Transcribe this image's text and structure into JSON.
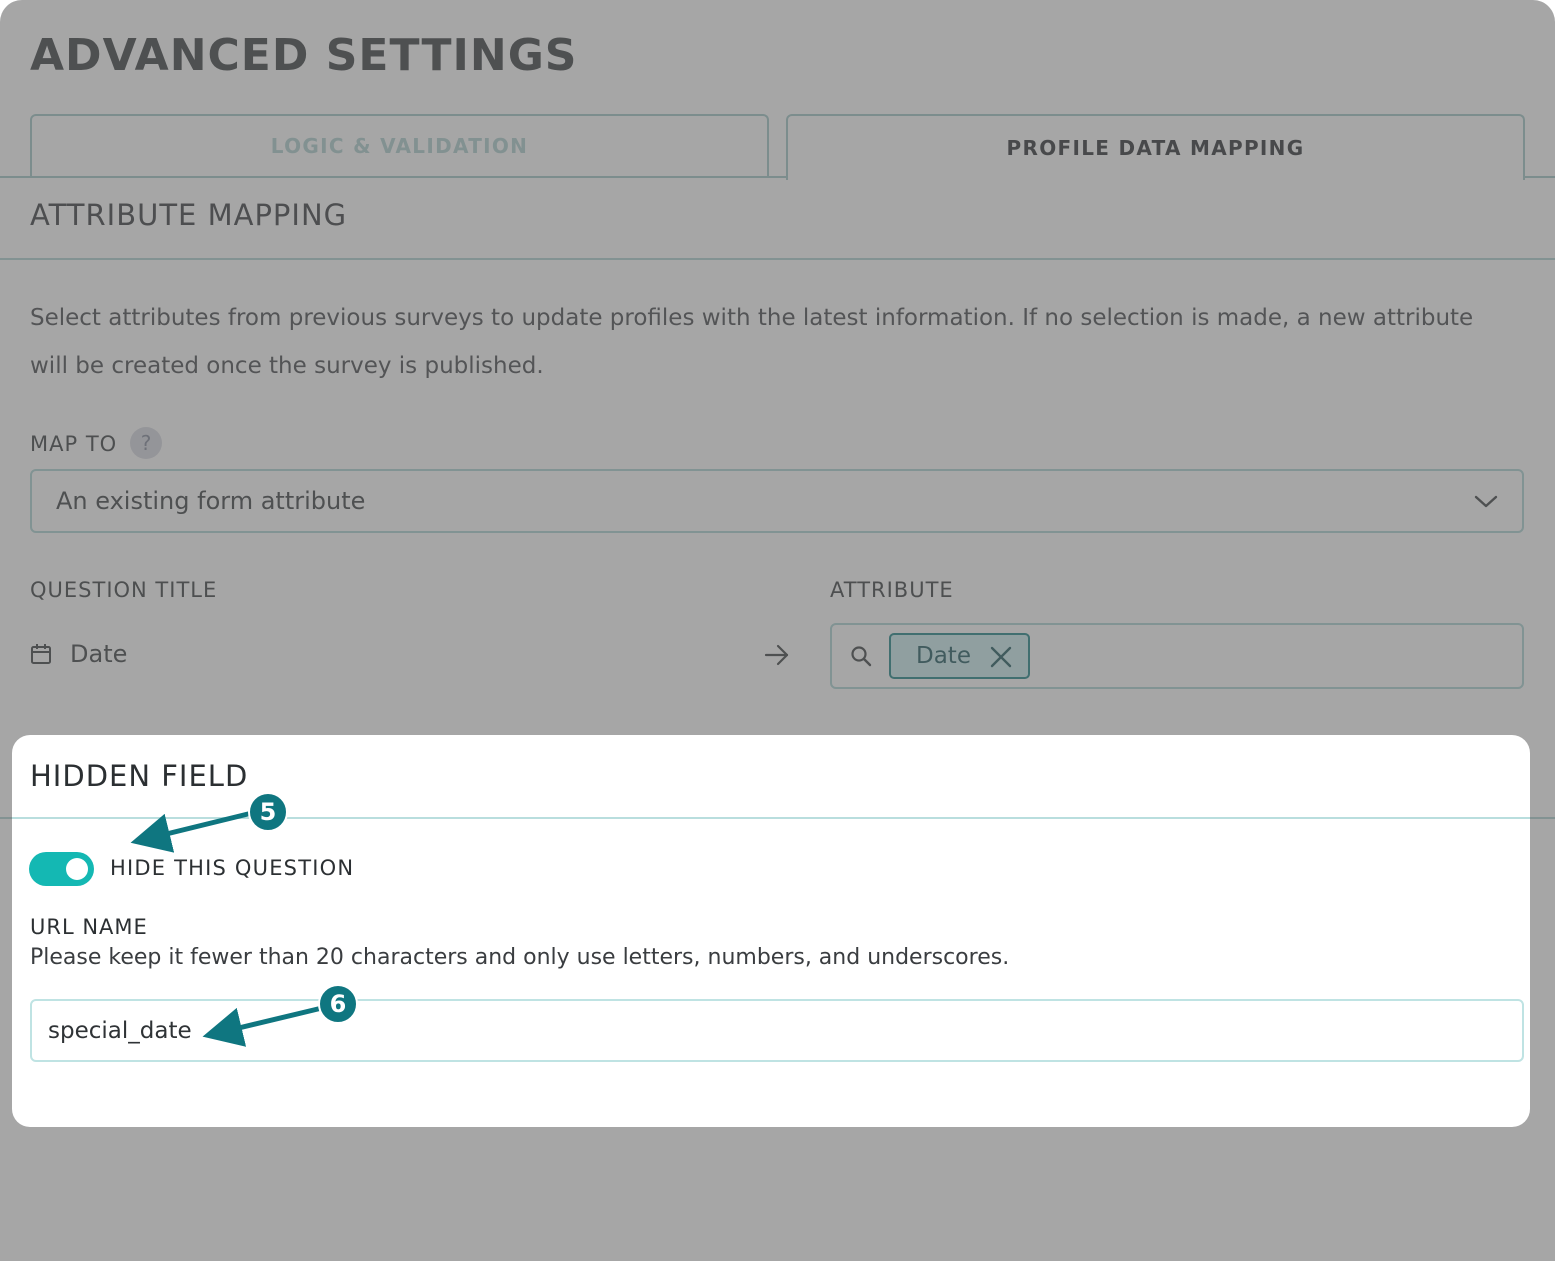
{
  "page": {
    "title": "ADVANCED SETTINGS"
  },
  "tabs": [
    {
      "label": "LOGIC & VALIDATION",
      "active": false
    },
    {
      "label": "PROFILE DATA MAPPING",
      "active": true
    }
  ],
  "attribute_mapping": {
    "title": "ATTRIBUTE MAPPING",
    "description": "Select attributes from previous surveys to update profiles with the latest information. If no selection is made, a new attribute will be created once the survey is published.",
    "map_to": {
      "label": "MAP TO",
      "help_icon": "?",
      "value": "An existing form attribute"
    },
    "question_title_label": "QUESTION TITLE",
    "attribute_label": "ATTRIBUTE",
    "question": {
      "icon": "calendar-icon",
      "text": "Date"
    },
    "attribute_chip": "Date"
  },
  "hidden_field": {
    "title": "HIDDEN FIELD",
    "toggle_label": "HIDE THIS QUESTION",
    "toggle_on": true,
    "url_label": "URL NAME",
    "url_help": "Please keep it fewer than 20 characters and only use letters, numbers, and underscores.",
    "url_value": "special_date"
  },
  "annotations": [
    {
      "number": "5"
    },
    {
      "number": "6"
    }
  ],
  "colors": {
    "accent": "#14b8b3",
    "annotation": "#0f7680",
    "chip_bg": "#cbeef0",
    "chip_border": "#0f7d7f",
    "overlay": "rgba(102,102,102,0.58)"
  }
}
